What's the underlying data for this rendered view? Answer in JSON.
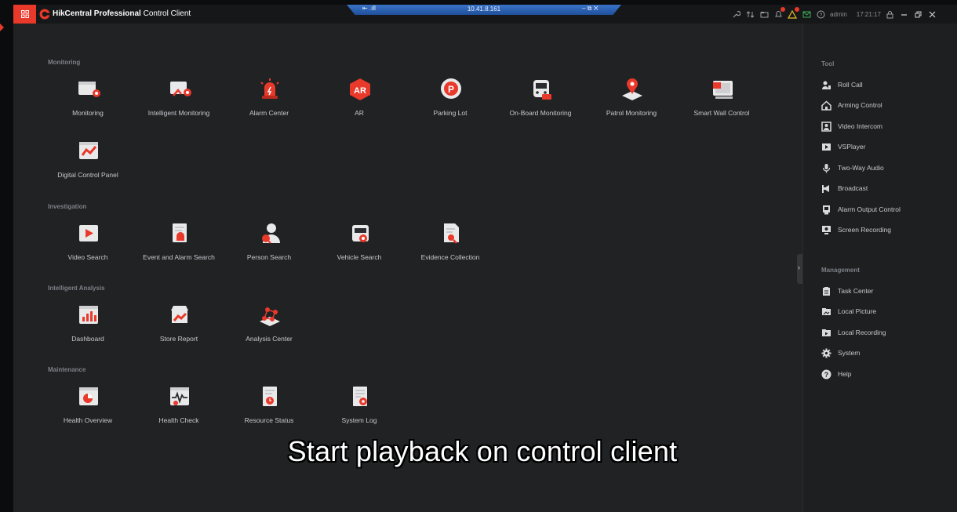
{
  "app": {
    "title_bold": "HikCentral Professional",
    "title_rest": "Control Client",
    "user": "admin",
    "time": "17:21:17"
  },
  "remote": {
    "ip": "10.41.8.161",
    "left_controls": "⇤ .ıll",
    "right_controls": "–  ⧉  ✕"
  },
  "sections": {
    "monitoring": {
      "title": "Monitoring",
      "items": [
        {
          "label": "Monitoring",
          "icon": "monitoring-icon"
        },
        {
          "label": "Intelligent Monitoring",
          "icon": "intelligent-monitoring-icon"
        },
        {
          "label": "Alarm Center",
          "icon": "alarm-center-icon"
        },
        {
          "label": "AR",
          "icon": "ar-icon"
        },
        {
          "label": "Parking Lot",
          "icon": "parking-lot-icon"
        },
        {
          "label": "On-Board Monitoring",
          "icon": "on-board-monitoring-icon"
        },
        {
          "label": "Patrol Monitoring",
          "icon": "patrol-monitoring-icon"
        },
        {
          "label": "Smart Wall Control",
          "icon": "smart-wall-control-icon"
        },
        {
          "label": "Digital Control Panel",
          "icon": "digital-control-panel-icon"
        }
      ]
    },
    "investigation": {
      "title": "Investigation",
      "items": [
        {
          "label": "Video Search",
          "icon": "video-search-icon"
        },
        {
          "label": "Event and Alarm Search",
          "icon": "event-alarm-search-icon"
        },
        {
          "label": "Person Search",
          "icon": "person-search-icon"
        },
        {
          "label": "Vehicle Search",
          "icon": "vehicle-search-icon"
        },
        {
          "label": "Evidence Collection",
          "icon": "evidence-collection-icon"
        }
      ]
    },
    "analysis": {
      "title": "Intelligent Analysis",
      "items": [
        {
          "label": "Dashboard",
          "icon": "dashboard-icon"
        },
        {
          "label": "Store Report",
          "icon": "store-report-icon"
        },
        {
          "label": "Analysis Center",
          "icon": "analysis-center-icon"
        }
      ]
    },
    "maintenance": {
      "title": "Maintenance",
      "items": [
        {
          "label": "Health Overview",
          "icon": "health-overview-icon"
        },
        {
          "label": "Health Check",
          "icon": "health-check-icon"
        },
        {
          "label": "Resource Status",
          "icon": "resource-status-icon"
        },
        {
          "label": "System Log",
          "icon": "system-log-icon"
        }
      ]
    }
  },
  "tool": {
    "title": "Tool",
    "items": [
      {
        "label": "Roll Call",
        "icon": "roll-call-icon"
      },
      {
        "label": "Arming Control",
        "icon": "arming-control-icon"
      },
      {
        "label": "Video Intercom",
        "icon": "video-intercom-icon"
      },
      {
        "label": "VSPlayer",
        "icon": "vsplayer-icon"
      },
      {
        "label": "Two-Way Audio",
        "icon": "microphone-icon"
      },
      {
        "label": "Broadcast",
        "icon": "broadcast-icon"
      },
      {
        "label": "Alarm Output Control",
        "icon": "alarm-output-icon"
      },
      {
        "label": "Screen Recording",
        "icon": "screen-recording-icon"
      }
    ]
  },
  "management": {
    "title": "Management",
    "items": [
      {
        "label": "Task Center",
        "icon": "task-center-icon"
      },
      {
        "label": "Local Picture",
        "icon": "local-picture-icon"
      },
      {
        "label": "Local Recording",
        "icon": "local-recording-icon"
      },
      {
        "label": "System",
        "icon": "gear-icon"
      },
      {
        "label": "Help",
        "icon": "help-icon"
      }
    ]
  },
  "caption": "Start playback on control client",
  "colors": {
    "accent": "#e8392b",
    "background": "#202224",
    "titlebar": "#161718",
    "remote_bar": "#2f62b3"
  }
}
